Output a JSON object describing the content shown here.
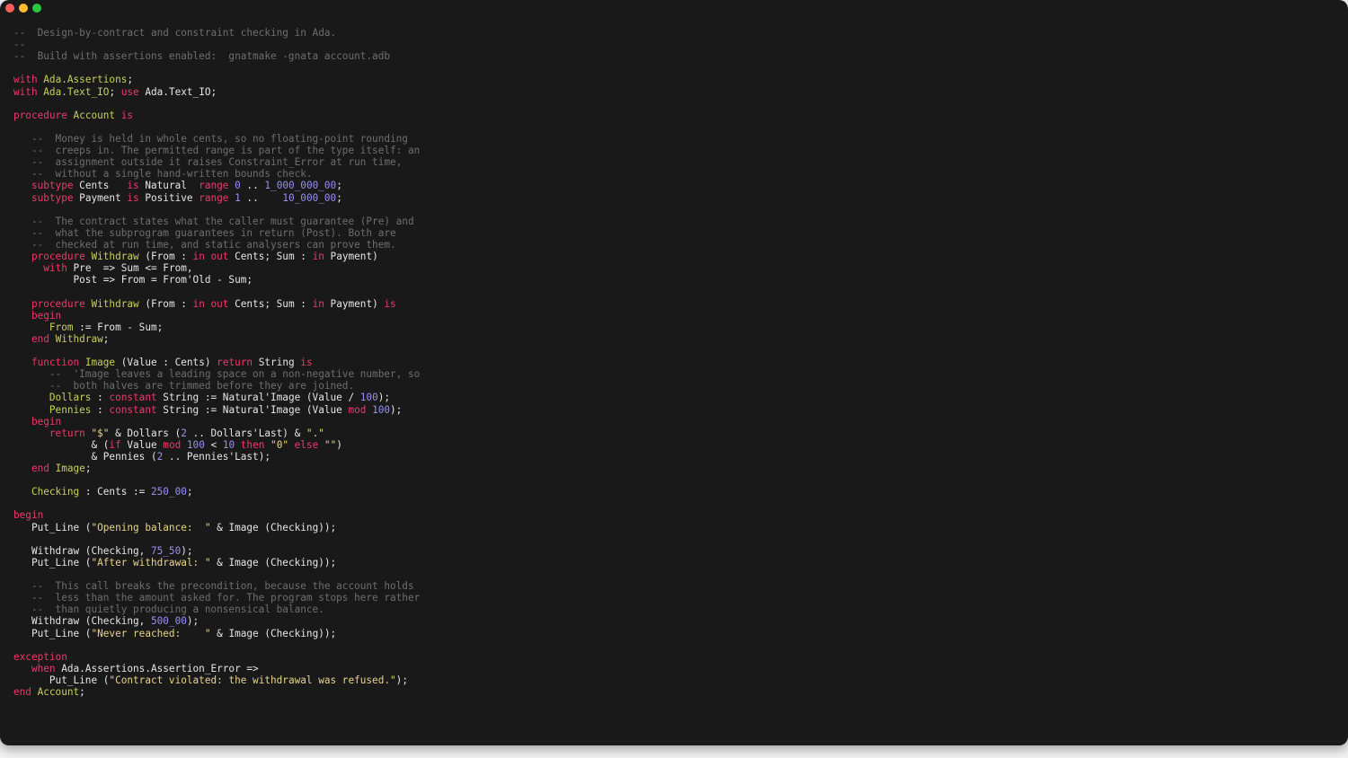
{
  "window": {
    "traffic_lights": [
      {
        "name": "close",
        "color": "#ff5f57"
      },
      {
        "name": "minimize",
        "color": "#febc2e"
      },
      {
        "name": "maximize",
        "color": "#28c840"
      }
    ]
  },
  "colors": {
    "background": "#191919",
    "plain": "#e6e6e6",
    "keyword": "#f0386b",
    "name": "#c9d05c",
    "string": "#e8d48a",
    "number": "#9b8ff2",
    "comment": "#6e6e6e"
  },
  "editor": {
    "language": "Ada",
    "lines": [
      [
        [
          "comment",
          "--  Design-by-contract and constraint checking in Ada."
        ]
      ],
      [
        [
          "comment",
          "--"
        ]
      ],
      [
        [
          "comment",
          "--  Build with assertions enabled:  gnatmake -gnata account.adb"
        ]
      ],
      [],
      [
        [
          "keyword",
          "with"
        ],
        [
          "plain",
          " "
        ],
        [
          "name",
          "Ada.Assertions"
        ],
        [
          "plain",
          ";"
        ]
      ],
      [
        [
          "keyword",
          "with"
        ],
        [
          "plain",
          " "
        ],
        [
          "name",
          "Ada.Text_IO"
        ],
        [
          "plain",
          "; "
        ],
        [
          "keyword",
          "use"
        ],
        [
          "plain",
          " Ada.Text_IO;"
        ]
      ],
      [],
      [
        [
          "keyword",
          "procedure"
        ],
        [
          "plain",
          " "
        ],
        [
          "name",
          "Account"
        ],
        [
          "plain",
          " "
        ],
        [
          "keyword",
          "is"
        ]
      ],
      [],
      [
        [
          "comment",
          "   --  Money is held in whole cents, so no floating-point rounding"
        ]
      ],
      [
        [
          "comment",
          "   --  creeps in. The permitted range is part of the type itself: an"
        ]
      ],
      [
        [
          "comment",
          "   --  assignment outside it raises Constraint_Error at run time,"
        ]
      ],
      [
        [
          "comment",
          "   --  without a single hand-written bounds check."
        ]
      ],
      [
        [
          "plain",
          "   "
        ],
        [
          "keyword",
          "subtype"
        ],
        [
          "plain",
          " Cents   "
        ],
        [
          "keyword",
          "is"
        ],
        [
          "plain",
          " Natural  "
        ],
        [
          "keyword",
          "range"
        ],
        [
          "plain",
          " "
        ],
        [
          "number",
          "0"
        ],
        [
          "plain",
          " .. "
        ],
        [
          "number",
          "1_000_000_00"
        ],
        [
          "plain",
          ";"
        ]
      ],
      [
        [
          "plain",
          "   "
        ],
        [
          "keyword",
          "subtype"
        ],
        [
          "plain",
          " Payment "
        ],
        [
          "keyword",
          "is"
        ],
        [
          "plain",
          " Positive "
        ],
        [
          "keyword",
          "range"
        ],
        [
          "plain",
          " "
        ],
        [
          "number",
          "1"
        ],
        [
          "plain",
          " ..    "
        ],
        [
          "number",
          "10_000_00"
        ],
        [
          "plain",
          ";"
        ]
      ],
      [],
      [
        [
          "comment",
          "   --  The contract states what the caller must guarantee (Pre) and"
        ]
      ],
      [
        [
          "comment",
          "   --  what the subprogram guarantees in return (Post). Both are"
        ]
      ],
      [
        [
          "comment",
          "   --  checked at run time, and static analysers can prove them."
        ]
      ],
      [
        [
          "plain",
          "   "
        ],
        [
          "keyword",
          "procedure"
        ],
        [
          "plain",
          " "
        ],
        [
          "name",
          "Withdraw"
        ],
        [
          "plain",
          " (From : "
        ],
        [
          "keyword",
          "in out"
        ],
        [
          "plain",
          " Cents; Sum : "
        ],
        [
          "keyword",
          "in"
        ],
        [
          "plain",
          " Payment)"
        ]
      ],
      [
        [
          "plain",
          "     "
        ],
        [
          "keyword",
          "with"
        ],
        [
          "plain",
          " Pre  => Sum <= From,"
        ]
      ],
      [
        [
          "plain",
          "          Post => From = From'Old - Sum;"
        ]
      ],
      [],
      [
        [
          "plain",
          "   "
        ],
        [
          "keyword",
          "procedure"
        ],
        [
          "plain",
          " "
        ],
        [
          "name",
          "Withdraw"
        ],
        [
          "plain",
          " (From : "
        ],
        [
          "keyword",
          "in out"
        ],
        [
          "plain",
          " Cents; Sum : "
        ],
        [
          "keyword",
          "in"
        ],
        [
          "plain",
          " Payment) "
        ],
        [
          "keyword",
          "is"
        ]
      ],
      [
        [
          "plain",
          "   "
        ],
        [
          "keyword",
          "begin"
        ]
      ],
      [
        [
          "plain",
          "      "
        ],
        [
          "name",
          "From"
        ],
        [
          "plain",
          " := From - Sum;"
        ]
      ],
      [
        [
          "plain",
          "   "
        ],
        [
          "keyword",
          "end"
        ],
        [
          "plain",
          " "
        ],
        [
          "name",
          "Withdraw"
        ],
        [
          "plain",
          ";"
        ]
      ],
      [],
      [
        [
          "plain",
          "   "
        ],
        [
          "keyword",
          "function"
        ],
        [
          "plain",
          " "
        ],
        [
          "name",
          "Image"
        ],
        [
          "plain",
          " (Value : Cents) "
        ],
        [
          "keyword",
          "return"
        ],
        [
          "plain",
          " String "
        ],
        [
          "keyword",
          "is"
        ]
      ],
      [
        [
          "comment",
          "      --  'Image leaves a leading space on a non-negative number, so"
        ]
      ],
      [
        [
          "comment",
          "      --  both halves are trimmed before they are joined."
        ]
      ],
      [
        [
          "plain",
          "      "
        ],
        [
          "name",
          "Dollars"
        ],
        [
          "plain",
          " : "
        ],
        [
          "keyword",
          "constant"
        ],
        [
          "plain",
          " String := Natural'Image (Value / "
        ],
        [
          "number",
          "100"
        ],
        [
          "plain",
          ");"
        ]
      ],
      [
        [
          "plain",
          "      "
        ],
        [
          "name",
          "Pennies"
        ],
        [
          "plain",
          " : "
        ],
        [
          "keyword",
          "constant"
        ],
        [
          "plain",
          " String := Natural'Image (Value "
        ],
        [
          "keyword",
          "mod"
        ],
        [
          "plain",
          " "
        ],
        [
          "number",
          "100"
        ],
        [
          "plain",
          ");"
        ]
      ],
      [
        [
          "plain",
          "   "
        ],
        [
          "keyword",
          "begin"
        ]
      ],
      [
        [
          "plain",
          "      "
        ],
        [
          "keyword",
          "return"
        ],
        [
          "plain",
          " "
        ],
        [
          "string",
          "\"$\""
        ],
        [
          "plain",
          " & Dollars ("
        ],
        [
          "number",
          "2"
        ],
        [
          "plain",
          " .. Dollars'Last) & "
        ],
        [
          "string",
          "\".\""
        ]
      ],
      [
        [
          "plain",
          "             & ("
        ],
        [
          "keyword",
          "if"
        ],
        [
          "plain",
          " Value "
        ],
        [
          "keyword",
          "mod"
        ],
        [
          "plain",
          " "
        ],
        [
          "number",
          "100"
        ],
        [
          "plain",
          " < "
        ],
        [
          "number",
          "10"
        ],
        [
          "plain",
          " "
        ],
        [
          "keyword",
          "then"
        ],
        [
          "plain",
          " "
        ],
        [
          "string",
          "\"0\""
        ],
        [
          "plain",
          " "
        ],
        [
          "keyword",
          "else"
        ],
        [
          "plain",
          " "
        ],
        [
          "string",
          "\"\""
        ],
        [
          "plain",
          ")"
        ]
      ],
      [
        [
          "plain",
          "             & Pennies ("
        ],
        [
          "number",
          "2"
        ],
        [
          "plain",
          " .. Pennies'Last);"
        ]
      ],
      [
        [
          "plain",
          "   "
        ],
        [
          "keyword",
          "end"
        ],
        [
          "plain",
          " "
        ],
        [
          "name",
          "Image"
        ],
        [
          "plain",
          ";"
        ]
      ],
      [],
      [
        [
          "plain",
          "   "
        ],
        [
          "name",
          "Checking"
        ],
        [
          "plain",
          " : Cents := "
        ],
        [
          "number",
          "250_00"
        ],
        [
          "plain",
          ";"
        ]
      ],
      [],
      [
        [
          "keyword",
          "begin"
        ]
      ],
      [
        [
          "plain",
          "   Put_Line ("
        ],
        [
          "string",
          "\"Opening balance:  \""
        ],
        [
          "plain",
          " & Image (Checking));"
        ]
      ],
      [],
      [
        [
          "plain",
          "   Withdraw (Checking, "
        ],
        [
          "number",
          "75_50"
        ],
        [
          "plain",
          ");"
        ]
      ],
      [
        [
          "plain",
          "   Put_Line ("
        ],
        [
          "string",
          "\"After withdrawal: \""
        ],
        [
          "plain",
          " & Image (Checking));"
        ]
      ],
      [],
      [
        [
          "comment",
          "   --  This call breaks the precondition, because the account holds"
        ]
      ],
      [
        [
          "comment",
          "   --  less than the amount asked for. The program stops here rather"
        ]
      ],
      [
        [
          "comment",
          "   --  than quietly producing a nonsensical balance."
        ]
      ],
      [
        [
          "plain",
          "   Withdraw (Checking, "
        ],
        [
          "number",
          "500_00"
        ],
        [
          "plain",
          ");"
        ]
      ],
      [
        [
          "plain",
          "   Put_Line ("
        ],
        [
          "string",
          "\"Never reached:    \""
        ],
        [
          "plain",
          " & Image (Checking));"
        ]
      ],
      [],
      [
        [
          "keyword",
          "exception"
        ]
      ],
      [
        [
          "plain",
          "   "
        ],
        [
          "keyword",
          "when"
        ],
        [
          "plain",
          " Ada.Assertions.Assertion_Error =>"
        ]
      ],
      [
        [
          "plain",
          "      Put_Line ("
        ],
        [
          "string",
          "\"Contract violated: the withdrawal was refused.\""
        ],
        [
          "plain",
          ");"
        ]
      ],
      [
        [
          "keyword",
          "end"
        ],
        [
          "plain",
          " "
        ],
        [
          "name",
          "Account"
        ],
        [
          "plain",
          ";"
        ]
      ]
    ]
  }
}
